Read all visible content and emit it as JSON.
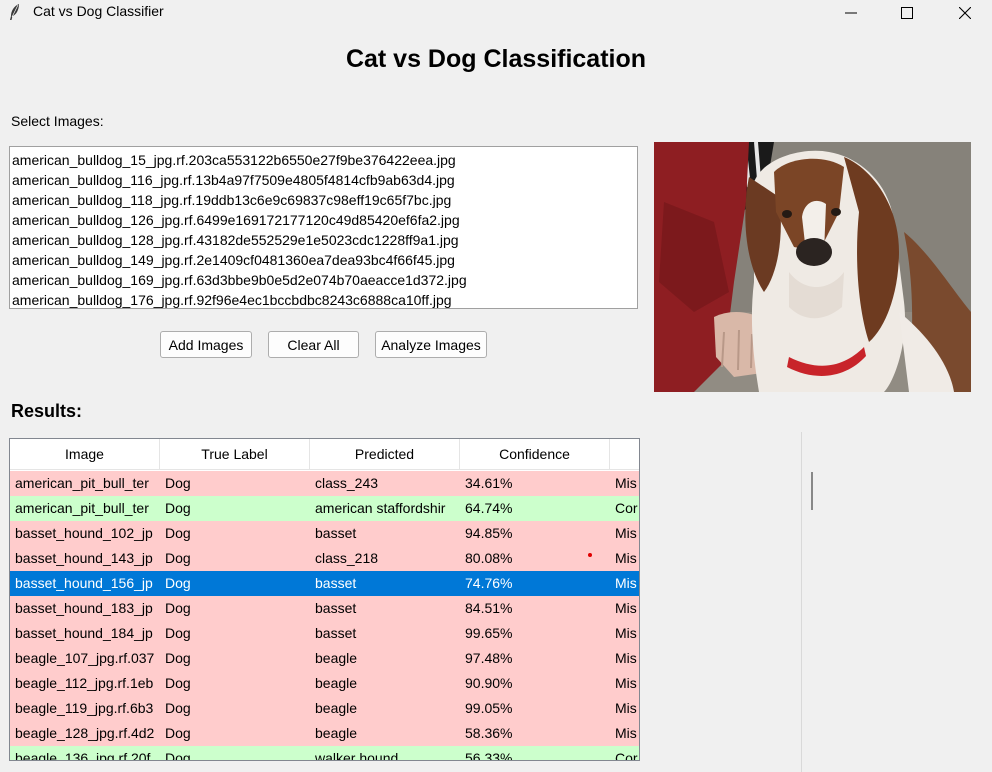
{
  "window": {
    "title": "Cat vs Dog Classifier",
    "app_icon": "feather-icon",
    "controls": [
      "minimize-icon",
      "maximize-icon",
      "close-icon"
    ]
  },
  "heading": "Cat vs Dog Classification",
  "select_label": "Select Images:",
  "files": [
    "american_bulldog_15_jpg.rf.203ca553122b6550e27f9be376422eea.jpg",
    "american_bulldog_116_jpg.rf.13b4a97f7509e4805f4814cfb9ab63d4.jpg",
    "american_bulldog_118_jpg.rf.19ddb13c6e9c69837c98eff19c65f7bc.jpg",
    "american_bulldog_126_jpg.rf.6499e169172177120c49d85420ef6fa2.jpg",
    "american_bulldog_128_jpg.rf.43182de552529e1e5023cdc1228ff9a1.jpg",
    "american_bulldog_149_jpg.rf.2e1409cf0481360ea7dea93bc4f66f45.jpg",
    "american_bulldog_169_jpg.rf.63d3bbe9b0e5d2e074b70aeacce1d372.jpg",
    "american_bulldog_176_jpg.rf.92f96e4ec1bccbdbc8243c6888ca10ff.jpg"
  ],
  "buttons": {
    "add": "Add Images",
    "clear": "Clear All",
    "analyze": "Analyze Images"
  },
  "results_label": "Results:",
  "table": {
    "columns": [
      "Image",
      "True Label",
      "Predicted",
      "Confidence",
      ""
    ],
    "rows": [
      {
        "image": "american_pit_bull_ter",
        "true": "Dog",
        "pred": "class_243",
        "conf": "34.61%",
        "status": "Mis",
        "state": "wrong"
      },
      {
        "image": "american_pit_bull_ter",
        "true": "Dog",
        "pred": "american staffordshir",
        "conf": "64.74%",
        "status": "Cor",
        "state": "correct"
      },
      {
        "image": "basset_hound_102_jp",
        "true": "Dog",
        "pred": "basset",
        "conf": "94.85%",
        "status": "Mis",
        "state": "wrong"
      },
      {
        "image": "basset_hound_143_jp",
        "true": "Dog",
        "pred": "class_218",
        "conf": "80.08%",
        "status": "Mis",
        "state": "wrong"
      },
      {
        "image": "basset_hound_156_jp",
        "true": "Dog",
        "pred": "basset",
        "conf": "74.76%",
        "status": "Mis",
        "state": "selected"
      },
      {
        "image": "basset_hound_183_jp",
        "true": "Dog",
        "pred": "basset",
        "conf": "84.51%",
        "status": "Mis",
        "state": "wrong"
      },
      {
        "image": "basset_hound_184_jp",
        "true": "Dog",
        "pred": "basset",
        "conf": "99.65%",
        "status": "Mis",
        "state": "wrong"
      },
      {
        "image": "beagle_107_jpg.rf.037",
        "true": "Dog",
        "pred": "beagle",
        "conf": "97.48%",
        "status": "Mis",
        "state": "wrong"
      },
      {
        "image": "beagle_112_jpg.rf.1eb",
        "true": "Dog",
        "pred": "beagle",
        "conf": "90.90%",
        "status": "Mis",
        "state": "wrong"
      },
      {
        "image": "beagle_119_jpg.rf.6b3",
        "true": "Dog",
        "pred": "beagle",
        "conf": "99.05%",
        "status": "Mis",
        "state": "wrong"
      },
      {
        "image": "beagle_128_jpg.rf.4d2",
        "true": "Dog",
        "pred": "beagle",
        "conf": "58.36%",
        "status": "Mis",
        "state": "wrong"
      },
      {
        "image": "beagle_136_jpg.rf.20f",
        "true": "Dog",
        "pred": "walker hound",
        "conf": "56.33%",
        "status": "Cor",
        "state": "correct"
      }
    ]
  },
  "colors": {
    "wrong_row": "#ffcccc",
    "correct_row": "#ccffcc",
    "selected_row": "#0078d7"
  }
}
